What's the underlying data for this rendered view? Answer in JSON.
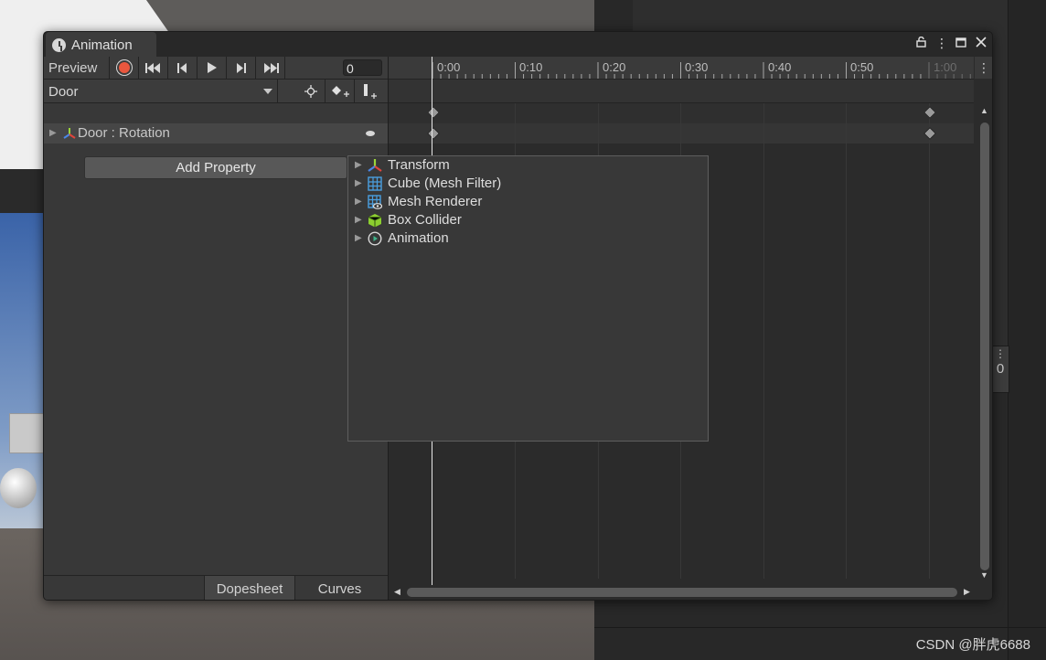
{
  "window": {
    "tab_title": "Animation",
    "preview_label": "Preview",
    "frame_value": "0",
    "clip_name": "Door"
  },
  "timeline": {
    "ticks": [
      "0:00",
      "0:10",
      "0:20",
      "0:30",
      "0:40",
      "0:50",
      "1:00"
    ]
  },
  "properties": [
    {
      "label": "Door : Rotation"
    }
  ],
  "add_property_label": "Add Property",
  "component_menu": [
    {
      "label": "Transform",
      "icon": "transform-icon"
    },
    {
      "label": "Cube (Mesh Filter)",
      "icon": "mesh-filter-icon"
    },
    {
      "label": "Mesh Renderer",
      "icon": "mesh-renderer-icon"
    },
    {
      "label": "Box Collider",
      "icon": "box-collider-icon"
    },
    {
      "label": "Animation",
      "icon": "animation-icon"
    }
  ],
  "bottom_tabs": {
    "dopesheet": "Dopesheet",
    "curves": "Curves"
  },
  "side_panel_value": "0",
  "watermark": "CSDN @胖虎6688",
  "colors": {
    "record": "#e9573e",
    "accent_green": "#9bd53a",
    "transform_red": "#e0453c",
    "transform_blue": "#4a86e8"
  }
}
